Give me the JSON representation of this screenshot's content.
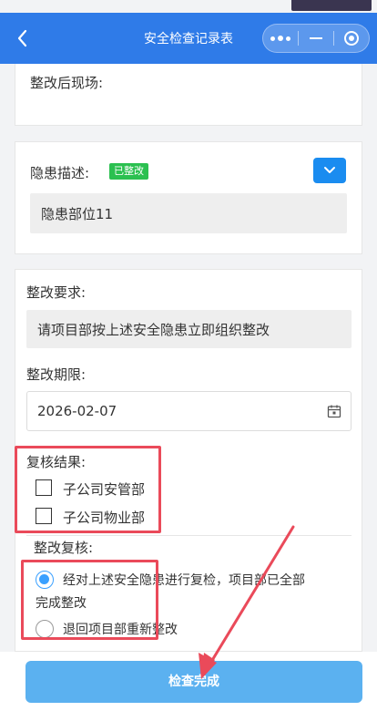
{
  "nav": {
    "back_icon": "chevron-left-icon",
    "title": "安全检查记录表",
    "capsule_icons": [
      "more-dots-icon",
      "minimize-icon",
      "target-icon"
    ]
  },
  "after_rectify": {
    "label": "整改后现场:"
  },
  "hazard": {
    "label": "隐患描述:",
    "status_badge": "已整改",
    "status_color": "#2bc050",
    "expand_icon": "chevron-down-icon",
    "value": "隐患部位11"
  },
  "requirement": {
    "label": "整改要求:",
    "value": "请项目部按上述安全隐患立即组织整改"
  },
  "deadline": {
    "label": "整改期限:",
    "value": "2026-02-07",
    "icon": "calendar-icon"
  },
  "review_result": {
    "label": "复核结果:",
    "options": [
      {
        "label": "子公司安管部",
        "checked": false
      },
      {
        "label": "子公司物业部",
        "checked": false
      }
    ]
  },
  "rectify_review": {
    "label": "整改复核:",
    "options": [
      {
        "line1": "经对上述安全隐患进行复检，项目部已全部",
        "line2": "完成整改",
        "selected": true
      },
      {
        "line1": "退回项目部重新整改",
        "selected": false
      }
    ]
  },
  "footer": {
    "submit_label": "检查完成"
  },
  "colors": {
    "primary": "#2f7be8",
    "accent": "#1a8cf0",
    "highlight": "#ea4a5a",
    "submit": "#5bb1f0"
  }
}
